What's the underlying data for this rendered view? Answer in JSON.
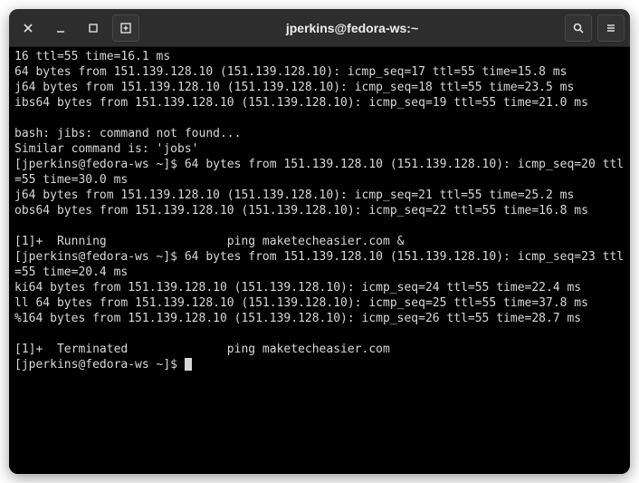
{
  "titlebar": {
    "title": "jperkins@fedora-ws:~"
  },
  "terminal": {
    "lines": [
      "16 ttl=55 time=16.1 ms",
      "64 bytes from 151.139.128.10 (151.139.128.10): icmp_seq=17 ttl=55 time=15.8 ms",
      "j64 bytes from 151.139.128.10 (151.139.128.10): icmp_seq=18 ttl=55 time=23.5 ms",
      "ibs64 bytes from 151.139.128.10 (151.139.128.10): icmp_seq=19 ttl=55 time=21.0 ms",
      "",
      "bash: jibs: command not found...",
      "Similar command is: 'jobs'",
      "[jperkins@fedora-ws ~]$ 64 bytes from 151.139.128.10 (151.139.128.10): icmp_seq=20 ttl=55 time=30.0 ms",
      "j64 bytes from 151.139.128.10 (151.139.128.10): icmp_seq=21 ttl=55 time=25.2 ms",
      "obs64 bytes from 151.139.128.10 (151.139.128.10): icmp_seq=22 ttl=55 time=16.8 ms",
      "",
      "[1]+  Running                 ping maketecheasier.com &",
      "[jperkins@fedora-ws ~]$ 64 bytes from 151.139.128.10 (151.139.128.10): icmp_seq=23 ttl=55 time=20.4 ms",
      "ki64 bytes from 151.139.128.10 (151.139.128.10): icmp_seq=24 ttl=55 time=22.4 ms",
      "ll 64 bytes from 151.139.128.10 (151.139.128.10): icmp_seq=25 ttl=55 time=37.8 ms",
      "%164 bytes from 151.139.128.10 (151.139.128.10): icmp_seq=26 ttl=55 time=28.7 ms",
      "",
      "[1]+  Terminated              ping maketecheasier.com"
    ],
    "prompt": "[jperkins@fedora-ws ~]$ "
  }
}
